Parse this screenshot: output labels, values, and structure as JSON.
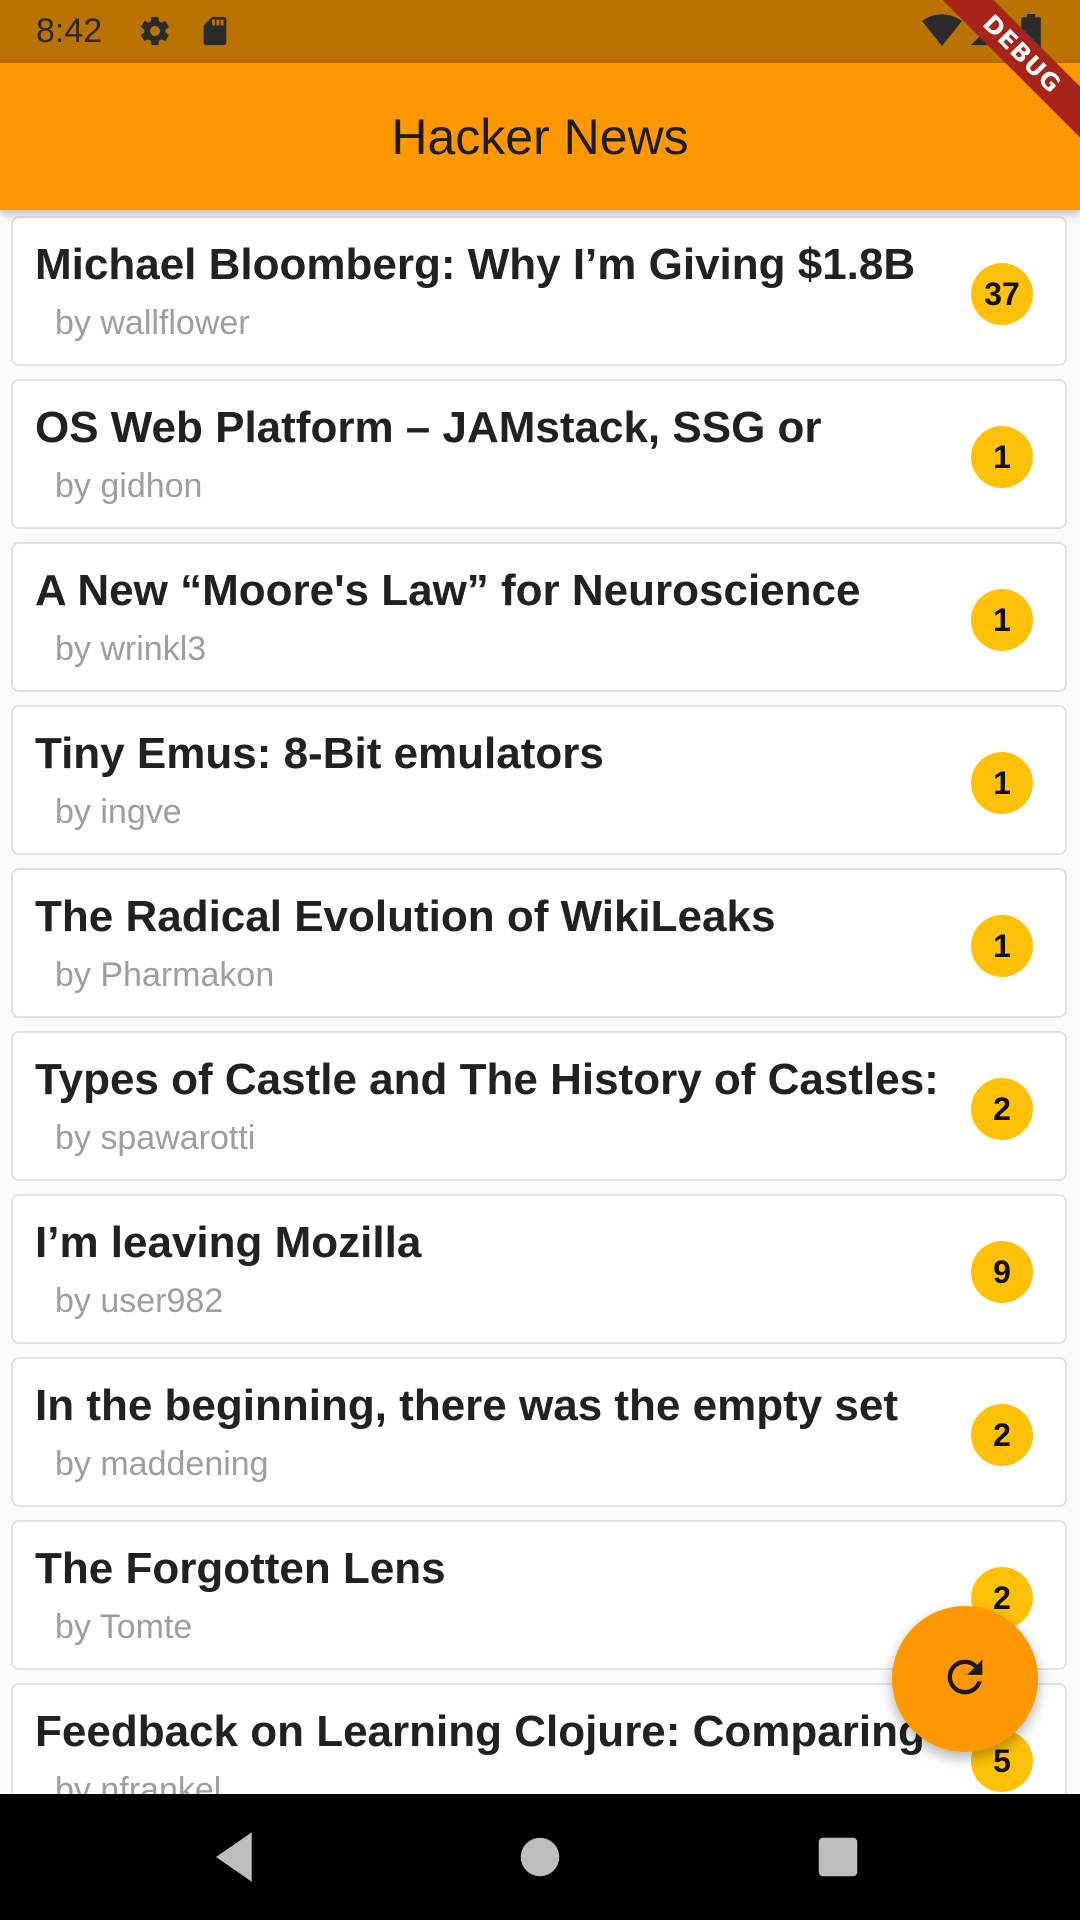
{
  "status_bar": {
    "time": "8:42",
    "icons": [
      "gear-icon",
      "sd-card-icon",
      "wifi-icon",
      "signal-icon",
      "battery-icon"
    ]
  },
  "app_bar": {
    "title": "Hacker News"
  },
  "debug_banner": "DEBUG",
  "stories": [
    {
      "title": "Michael Bloomberg: Why I’m Giving $1.8B",
      "author": "by wallflower",
      "count": "37"
    },
    {
      "title": "OS Web Platform – JAMstack, SSG or",
      "author": "by gidhon",
      "count": "1"
    },
    {
      "title": "A New “Moore's Law” for Neuroscience",
      "author": "by wrinkl3",
      "count": "1"
    },
    {
      "title": "Tiny Emus: 8-Bit emulators",
      "author": "by ingve",
      "count": "1"
    },
    {
      "title": "The Radical Evolution of WikiLeaks",
      "author": "by Pharmakon",
      "count": "1"
    },
    {
      "title": "Types of Castle and The History of Castles:",
      "author": "by spawarotti",
      "count": "2"
    },
    {
      "title": "I’m leaving Mozilla",
      "author": "by user982",
      "count": "9"
    },
    {
      "title": "In the beginning, there was the empty set",
      "author": "by maddening",
      "count": "2"
    },
    {
      "title": "The Forgotten Lens",
      "author": "by Tomte",
      "count": "2"
    },
    {
      "title": "Feedback on Learning Clojure: Comparing",
      "author": "by nfrankel",
      "count": "5"
    }
  ],
  "fab": {
    "icon": "refresh-icon"
  },
  "nav_bar": {
    "icons": [
      "back-icon",
      "home-icon",
      "recents-icon"
    ]
  },
  "colors": {
    "app_bar": "#ff9800",
    "status_bar": "#bb7300",
    "badge": "#ffc107",
    "debug": "#a8231a"
  }
}
